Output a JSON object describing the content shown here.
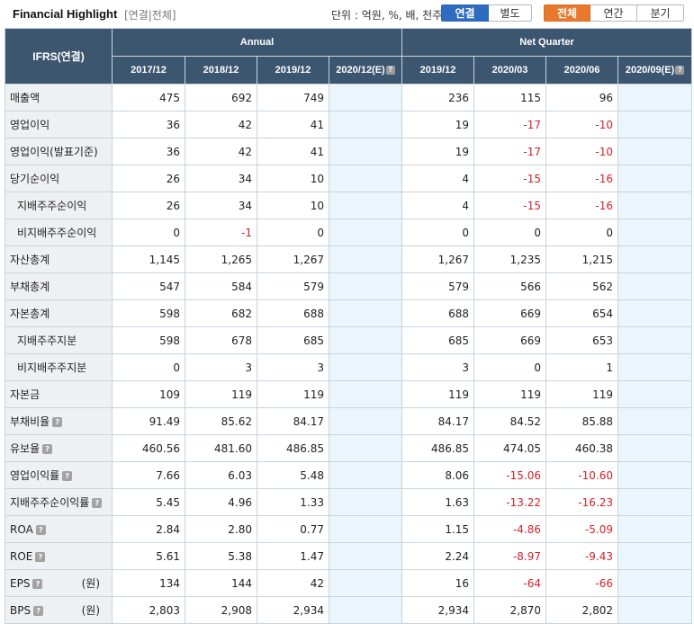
{
  "header": {
    "title": "Financial Highlight",
    "subtitle": "[연결|전체]",
    "unit": "단위 : 억원, %, 배, 천주",
    "btn_consolidated": "연결",
    "btn_separate": "별도",
    "btn_all": "전체",
    "btn_annual": "연간",
    "btn_quarter": "분기"
  },
  "table": {
    "corner_label": "IFRS(연결)",
    "group_annual": "Annual",
    "group_quarter": "Net Quarter",
    "columns": [
      "2017/12",
      "2018/12",
      "2019/12",
      "2020/12(E)",
      "2019/12",
      "2020/03",
      "2020/06",
      "2020/09(E)"
    ],
    "rows": [
      {
        "label": "매출액",
        "values": [
          "475",
          "692",
          "749",
          "",
          "236",
          "115",
          "96",
          ""
        ]
      },
      {
        "label": "영업이익",
        "values": [
          "36",
          "42",
          "41",
          "",
          "19",
          "-17",
          "-10",
          ""
        ]
      },
      {
        "label": "영업이익(발표기준)",
        "values": [
          "36",
          "42",
          "41",
          "",
          "19",
          "-17",
          "-10",
          ""
        ]
      },
      {
        "label": "당기순이익",
        "values": [
          "26",
          "34",
          "10",
          "",
          "4",
          "-15",
          "-16",
          ""
        ]
      },
      {
        "label": "지배주주순이익",
        "values": [
          "26",
          "34",
          "10",
          "",
          "4",
          "-15",
          "-16",
          ""
        ]
      },
      {
        "label": "비지배주주순이익",
        "values": [
          "0",
          "-1",
          "0",
          "",
          "0",
          "0",
          "0",
          ""
        ]
      },
      {
        "label": "자산총계",
        "values": [
          "1,145",
          "1,265",
          "1,267",
          "",
          "1,267",
          "1,235",
          "1,215",
          ""
        ]
      },
      {
        "label": "부채총계",
        "values": [
          "547",
          "584",
          "579",
          "",
          "579",
          "566",
          "562",
          ""
        ]
      },
      {
        "label": "자본총계",
        "values": [
          "598",
          "682",
          "688",
          "",
          "688",
          "669",
          "654",
          ""
        ]
      },
      {
        "label": "지배주주지분",
        "values": [
          "598",
          "678",
          "685",
          "",
          "685",
          "669",
          "653",
          ""
        ]
      },
      {
        "label": "비지배주주지분",
        "values": [
          "0",
          "3",
          "3",
          "",
          "3",
          "0",
          "1",
          ""
        ]
      },
      {
        "label": "자본금",
        "values": [
          "109",
          "119",
          "119",
          "",
          "119",
          "119",
          "119",
          ""
        ]
      },
      {
        "label": "부채비율",
        "values": [
          "91.49",
          "85.62",
          "84.17",
          "",
          "84.17",
          "84.52",
          "85.88",
          ""
        ]
      },
      {
        "label": "유보율",
        "values": [
          "460.56",
          "481.60",
          "486.85",
          "",
          "486.85",
          "474.05",
          "460.38",
          ""
        ]
      },
      {
        "label": "영업이익률",
        "values": [
          "7.66",
          "6.03",
          "5.48",
          "",
          "8.06",
          "-15.06",
          "-10.60",
          ""
        ]
      },
      {
        "label": "지배주주순이익률",
        "values": [
          "5.45",
          "4.96",
          "1.33",
          "",
          "1.63",
          "-13.22",
          "-16.23",
          ""
        ]
      },
      {
        "label": "ROA",
        "values": [
          "2.84",
          "2.80",
          "0.77",
          "",
          "1.15",
          "-4.86",
          "-5.09",
          ""
        ]
      },
      {
        "label": "ROE",
        "values": [
          "5.61",
          "5.38",
          "1.47",
          "",
          "2.24",
          "-8.97",
          "-9.43",
          ""
        ]
      },
      {
        "label": "EPS",
        "unit": "(원)",
        "values": [
          "134",
          "144",
          "42",
          "",
          "16",
          "-64",
          "-66",
          ""
        ]
      },
      {
        "label": "BPS",
        "unit": "(원)",
        "values": [
          "2,803",
          "2,908",
          "2,934",
          "",
          "2,934",
          "2,870",
          "2,802",
          ""
        ]
      }
    ]
  },
  "colors": {
    "header_bg": "#3d5670",
    "label_bg": "#eef1f4",
    "estimate_bg": "#eaf5fc",
    "negative": "#d2222a",
    "btn_blue": "#2d6cc0",
    "btn_orange": "#e8792c"
  }
}
